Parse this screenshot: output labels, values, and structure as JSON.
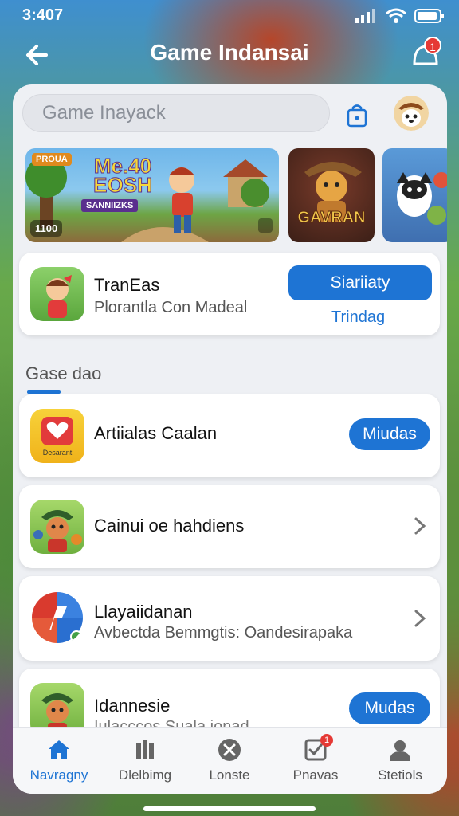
{
  "status": {
    "time": "3:407"
  },
  "header": {
    "title": "Game Indansai",
    "notification_count": "1"
  },
  "search": {
    "placeholder": "Game Inayack"
  },
  "banners": [
    {
      "title": "Me.40 EOSH",
      "tag": "PROUA",
      "sub": "SANNIIZKS",
      "count": "1100"
    },
    {
      "title": "GAVRAN"
    },
    {
      "title": ""
    }
  ],
  "featured": {
    "title": "TranEas",
    "subtitle": "Plorantla Con Madeal",
    "button": "Siariiaty",
    "link": "Trindag"
  },
  "section": {
    "label": "Gase dao"
  },
  "list": [
    {
      "title": "Artiialas Caalan",
      "subtitle": "",
      "action": "Miudas",
      "icon_label": "Desarant"
    },
    {
      "title": "Cainui oe hahdiens",
      "subtitle": ""
    },
    {
      "title": "Llayaiidanan",
      "subtitle": "Avbectda Bemmgtis: Oandesirapaka"
    },
    {
      "title": "Idannesie",
      "subtitle": "Iulacccos Suala ionad",
      "action": "Mudas"
    }
  ],
  "nav": [
    {
      "label": "Navragny"
    },
    {
      "label": "Dlelbimg"
    },
    {
      "label": "Lonste"
    },
    {
      "label": "Pnavas",
      "badge": "1"
    },
    {
      "label": "Stetiols"
    }
  ],
  "colors": {
    "accent": "#1e74d4",
    "badge": "#e53935",
    "sheet": "#eef0f4"
  }
}
